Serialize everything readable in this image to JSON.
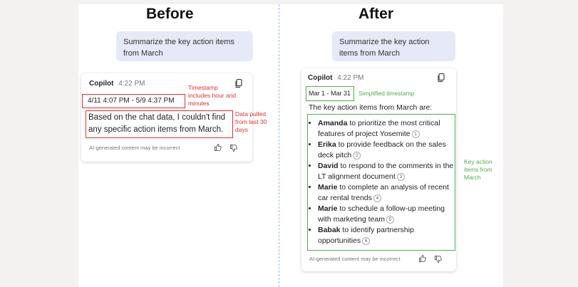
{
  "before": {
    "heading": "Before",
    "user_message": "Summarize the key action items from March",
    "card": {
      "name": "Copilot",
      "time": "4:22 PM",
      "timestamp": "4/11 4:07 PM - 5/9 4:37 PM",
      "answer": "Based on the chat data, I couldn't find any specific action items from March.",
      "disclaimer": "AI-generated content may be incorrect"
    },
    "annotations": {
      "timestamp_note": "Timestamp includes hour and minutes",
      "data_note": "Data pulled from last 30 days"
    }
  },
  "after": {
    "heading": "After",
    "user_message": "Summarize the key action items from March",
    "card": {
      "name": "Copilot",
      "time": "4:22 PM",
      "timestamp": "Mar 1 - Mar 31",
      "intro": "The key action items from March are:",
      "items": [
        {
          "person": "Amanda",
          "text": " to prioritize the most critical features of project Yosemite",
          "cite": "1"
        },
        {
          "person": "Erika",
          "text": " to provide feedback on the sales deck pitch",
          "cite": "2"
        },
        {
          "person": "David",
          "text": " to respond to the comments in the LT alignment document",
          "cite": "3"
        },
        {
          "person": "Marie",
          "text": " to complete an analysis of recent car rental trends",
          "cite": "4"
        },
        {
          "person": "Marie",
          "text": " to schedule a follow-up meeting with marketing team",
          "cite": "5"
        },
        {
          "person": "Babak",
          "text": " to identify partnership opportunities",
          "cite": "6"
        }
      ],
      "disclaimer": "AI-generated content may be incorrect"
    },
    "annotations": {
      "timestamp_note": "Simplified timestamp",
      "items_note": "Key action items from March"
    }
  },
  "icons": [
    "copy-icon",
    "thumbs-up-icon",
    "thumbs-down-icon"
  ],
  "colors": {
    "annotation_red": "#e03030",
    "annotation_green": "#4fae4a",
    "user_bubble": "#e6e9f7"
  }
}
